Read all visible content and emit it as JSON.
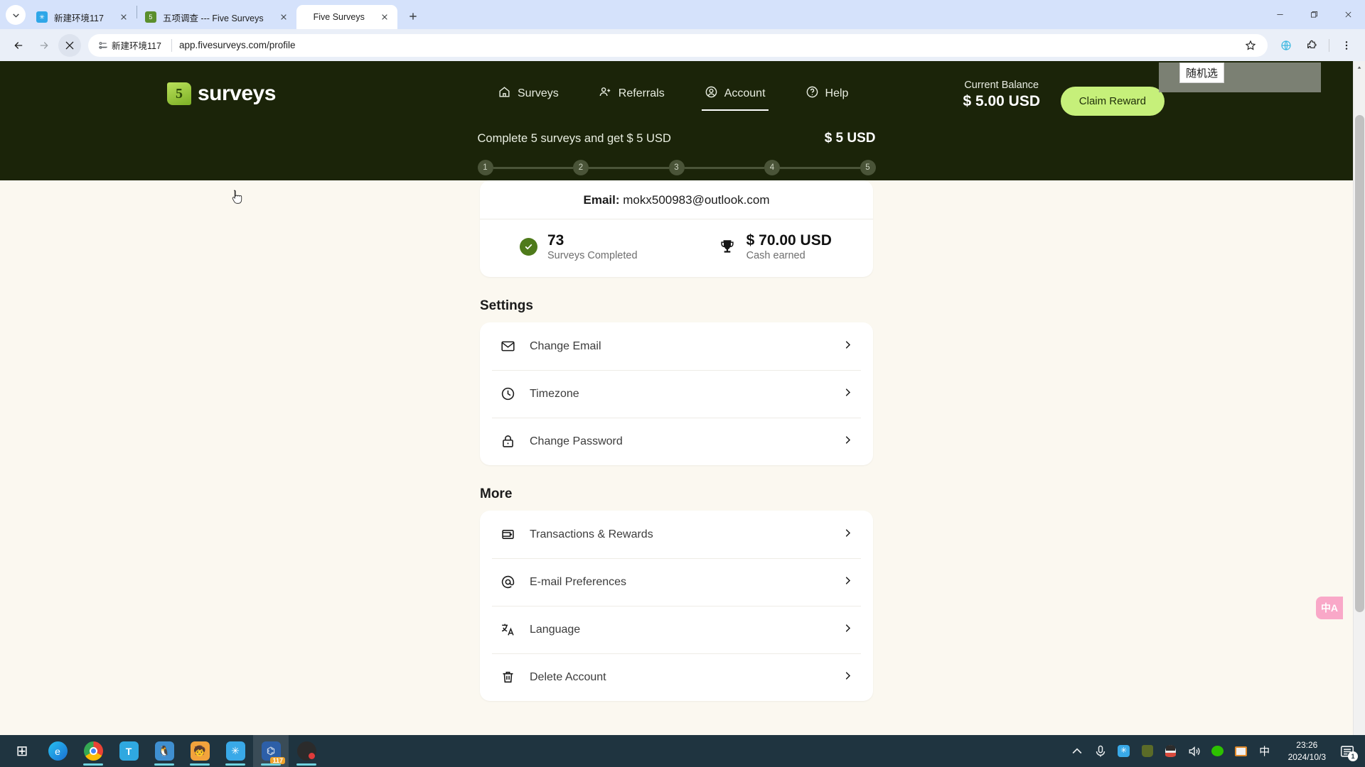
{
  "browser": {
    "tabs": [
      {
        "title": "新建环境117",
        "favicon": "network-icon",
        "active": false
      },
      {
        "title": "五项调查 --- Five Surveys",
        "favicon": "surveys-icon",
        "active": false
      },
      {
        "title": "Five Surveys",
        "favicon": "none",
        "active": true
      }
    ],
    "new_tab_label": "+",
    "window_controls": {
      "minimize": "–",
      "maximize": "❐",
      "close": "✕"
    },
    "toolbar": {
      "back": "back-icon",
      "forward": "forward-icon",
      "stop": "stop-icon",
      "profile_chip": "新建环境117",
      "url": "app.fivesurveys.com/profile",
      "bookmark": "star-icon",
      "translate": "globe-icon",
      "extensions": "puzzle-icon",
      "menu": "kebab-menu-icon"
    }
  },
  "site": {
    "logo": {
      "mark": "5",
      "text": "surveys"
    },
    "nav": [
      {
        "label": "Surveys",
        "icon": "home-icon",
        "active": false
      },
      {
        "label": "Referrals",
        "icon": "user-plus-icon",
        "active": false
      },
      {
        "label": "Account",
        "icon": "user-circle-icon",
        "active": true
      },
      {
        "label": "Help",
        "icon": "question-circle-icon",
        "active": false
      }
    ],
    "balance": {
      "label": "Current Balance",
      "value": "$ 5.00 USD",
      "claim_label": "Claim Reward"
    },
    "overlay_tooltip": "随机选",
    "progress": {
      "title": "Complete 5 surveys and get $ 5 USD",
      "amount": "$ 5 USD",
      "steps": [
        "1",
        "2",
        "3",
        "4",
        "5"
      ],
      "completed": 0
    },
    "profile": {
      "email_label": "Email:",
      "email_value": "mokx500983@outlook.com",
      "stats": [
        {
          "icon": "check-circle-icon",
          "value": "73",
          "label": "Surveys Completed"
        },
        {
          "icon": "trophy-icon",
          "value": "$ 70.00 USD",
          "label": "Cash earned"
        }
      ]
    },
    "settings": {
      "heading": "Settings",
      "rows": [
        {
          "icon": "mail-icon",
          "label": "Change Email"
        },
        {
          "icon": "clock-icon",
          "label": "Timezone"
        },
        {
          "icon": "lock-icon",
          "label": "Change Password"
        }
      ]
    },
    "more": {
      "heading": "More",
      "rows": [
        {
          "icon": "wallet-icon",
          "label": "Transactions & Rewards"
        },
        {
          "icon": "at-sign-icon",
          "label": "E-mail Preferences"
        },
        {
          "icon": "translate-icon",
          "label": "Language"
        },
        {
          "icon": "trash-icon",
          "label": "Delete Account"
        }
      ]
    },
    "translate_fab": "中A"
  },
  "taskbar": {
    "apps": [
      {
        "name": "start-button",
        "glyph": "⊞"
      },
      {
        "name": "edge",
        "glyph": "e"
      },
      {
        "name": "chrome",
        "glyph": "◉"
      },
      {
        "name": "text-tool",
        "glyph": "T"
      },
      {
        "name": "penguin-app",
        "glyph": "🐧"
      },
      {
        "name": "game-app",
        "glyph": "🧒"
      },
      {
        "name": "network-app",
        "glyph": "✳"
      },
      {
        "name": "browser-profile-app",
        "glyph": "⌬",
        "badge": "117"
      },
      {
        "name": "obs-app",
        "glyph": "◎"
      }
    ],
    "tray": {
      "chevron": "^",
      "icons": [
        "microphone-icon",
        "network-icon",
        "cat-icon",
        "qq-icon",
        "volume-icon",
        "wechat-icon",
        "window-icon"
      ],
      "ime": "中",
      "time": "23:26",
      "date": "2024/10/3",
      "notification_count": "1"
    }
  }
}
